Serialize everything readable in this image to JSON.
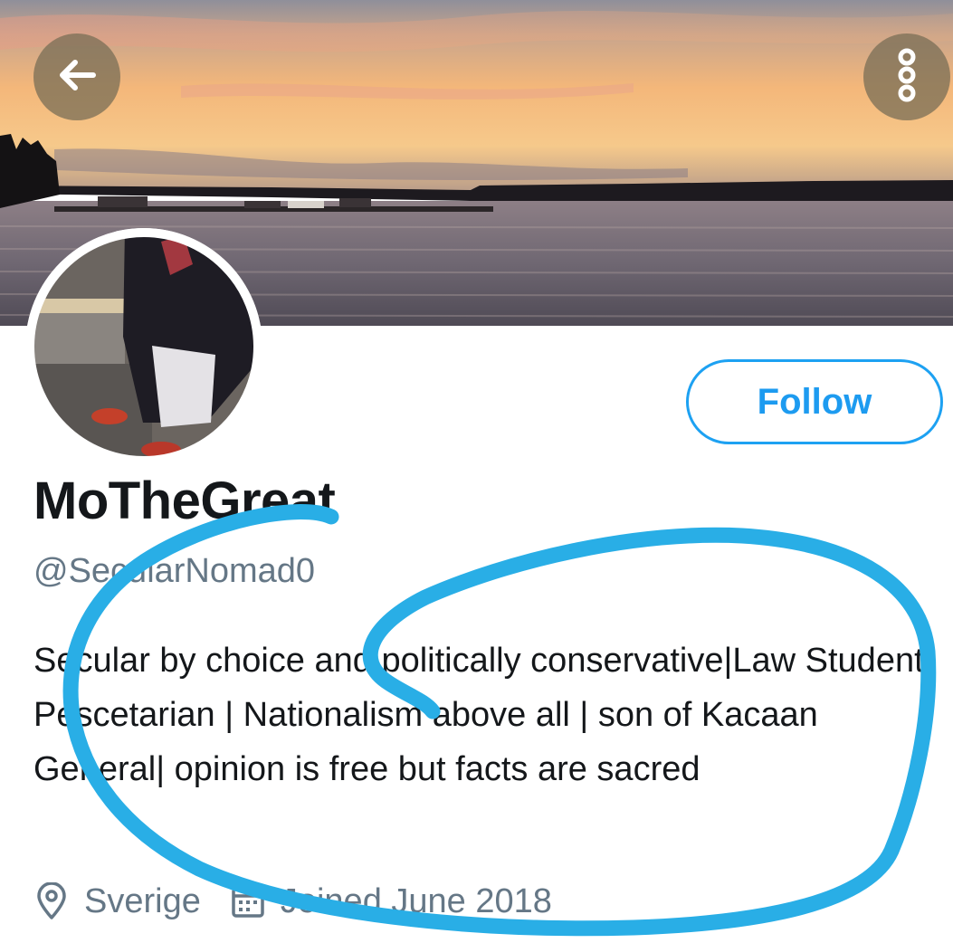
{
  "header": {
    "back_icon": "arrow-left-icon",
    "more_icon": "more-vertical-icon"
  },
  "profile": {
    "display_name": "MoTheGreat",
    "handle": "@SecularNomad0",
    "bio": "Secular by choice and politically conservative|Law Student| Pescetarian | Nationalism above all | son of Kacaan General| opinion is free but facts are sacred",
    "location": "Sverige",
    "joined": "Joined June 2018",
    "location_icon": "location-pin-icon",
    "joined_icon": "calendar-icon"
  },
  "actions": {
    "follow_label": "Follow"
  },
  "colors": {
    "accent": "#1da1f2",
    "scribble": "#29aee6",
    "text_primary": "#14171a",
    "text_secondary": "#657786"
  }
}
